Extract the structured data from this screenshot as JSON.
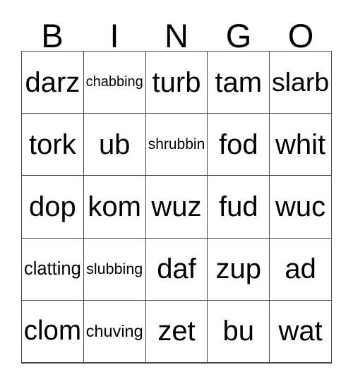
{
  "card": {
    "header": {
      "letters": [
        "B",
        "I",
        "N",
        "G",
        "O"
      ]
    },
    "grid": {
      "columns": 5,
      "rows": 5,
      "cells": [
        [
          "darz",
          "chabbing",
          "turb",
          "tam",
          "slarb"
        ],
        [
          "tork",
          "ub",
          "shrubbin",
          "fod",
          "whit"
        ],
        [
          "dop",
          "kom",
          "wuz",
          "fud",
          "wuc"
        ],
        [
          "clatting",
          "slubbing",
          "daf",
          "zup",
          "ad"
        ],
        [
          "clom",
          "chuving",
          "zet",
          "bu",
          "wat"
        ]
      ]
    },
    "colors": {
      "background": "#ffffff",
      "text": "#000000",
      "grid_line": "#4a4a4a"
    }
  }
}
